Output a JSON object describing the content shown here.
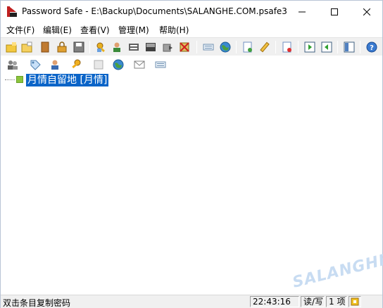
{
  "window": {
    "title": "Password Safe - E:\\Backup\\Documents\\SALANGHE.COM.psafe3"
  },
  "menu": {
    "items": [
      {
        "label": "文件(F)"
      },
      {
        "label": "编辑(E)"
      },
      {
        "label": "查看(V)"
      },
      {
        "label": "管理(M)"
      },
      {
        "label": "帮助(H)"
      }
    ]
  },
  "toolbar1": {
    "buttons": [
      {
        "icon": "new-database-icon"
      },
      {
        "icon": "open-database-icon"
      },
      {
        "icon": "close-database-icon"
      },
      {
        "icon": "lock-database-icon"
      },
      {
        "icon": "save-database-icon"
      },
      {
        "icon": "copy-password-icon"
      },
      {
        "icon": "copy-username-icon"
      },
      {
        "icon": "copy-notes-icon"
      },
      {
        "icon": "autotype-icon"
      },
      {
        "icon": "clear-clipboard-icon"
      },
      {
        "icon": "delete-entry-icon"
      },
      {
        "icon": "browse-url-icon"
      },
      {
        "icon": "globe-icon"
      },
      {
        "icon": "add-entry-icon"
      },
      {
        "icon": "edit-entry-icon"
      },
      {
        "icon": "delete-item-icon"
      },
      {
        "icon": "expand-all-icon"
      },
      {
        "icon": "collapse-all-icon"
      },
      {
        "icon": "options-icon"
      },
      {
        "icon": "help-icon"
      }
    ]
  },
  "toolbar2": {
    "buttons": [
      {
        "icon": "users-icon"
      },
      {
        "icon": "tag-icon"
      },
      {
        "icon": "user-icon"
      },
      {
        "icon": "key-icon"
      },
      {
        "icon": "notes-icon"
      },
      {
        "icon": "web-icon"
      },
      {
        "icon": "email-icon"
      },
      {
        "icon": "keyboard-icon"
      }
    ]
  },
  "tree": {
    "root_label": "月情自留地 [月情]"
  },
  "watermark": "SALANGHE",
  "status": {
    "message": "双击条目复制密码",
    "time": "22:43:16",
    "mode": "读/写",
    "count": "1 项"
  },
  "colors": {
    "selection": "#0a64c8",
    "node_icon": "#8cc43c"
  }
}
